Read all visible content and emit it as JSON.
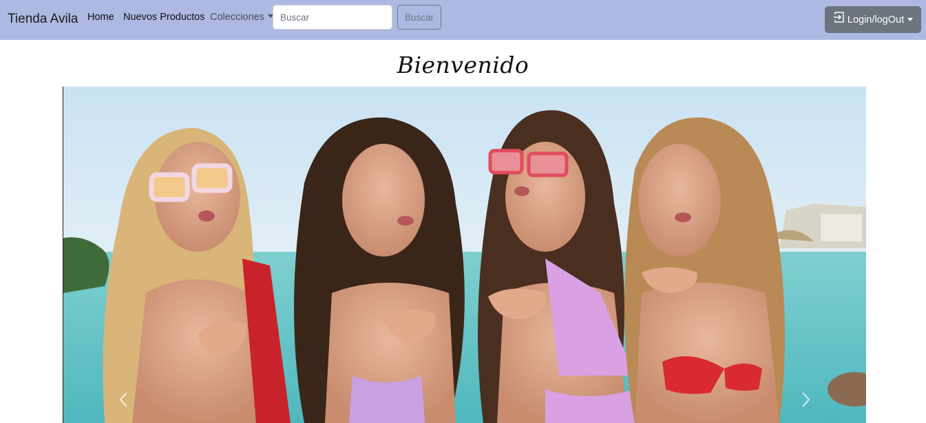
{
  "navbar": {
    "brand": "Tienda Avila",
    "links": [
      {
        "label": "Home"
      },
      {
        "label": "Nuevos Productos"
      },
      {
        "label": "Colecciones"
      }
    ],
    "search": {
      "placeholder": "Buscar",
      "button_label": "Buscar"
    },
    "login": {
      "label": "Login/logOut",
      "icon": "login-icon"
    },
    "colors": {
      "bar": "#adb9e3",
      "login_button": "#6c757d"
    }
  },
  "main": {
    "welcome": "Bienvenido",
    "carousel": {
      "prev_icon": "chevron-left-icon",
      "next_icon": "chevron-right-icon"
    }
  }
}
